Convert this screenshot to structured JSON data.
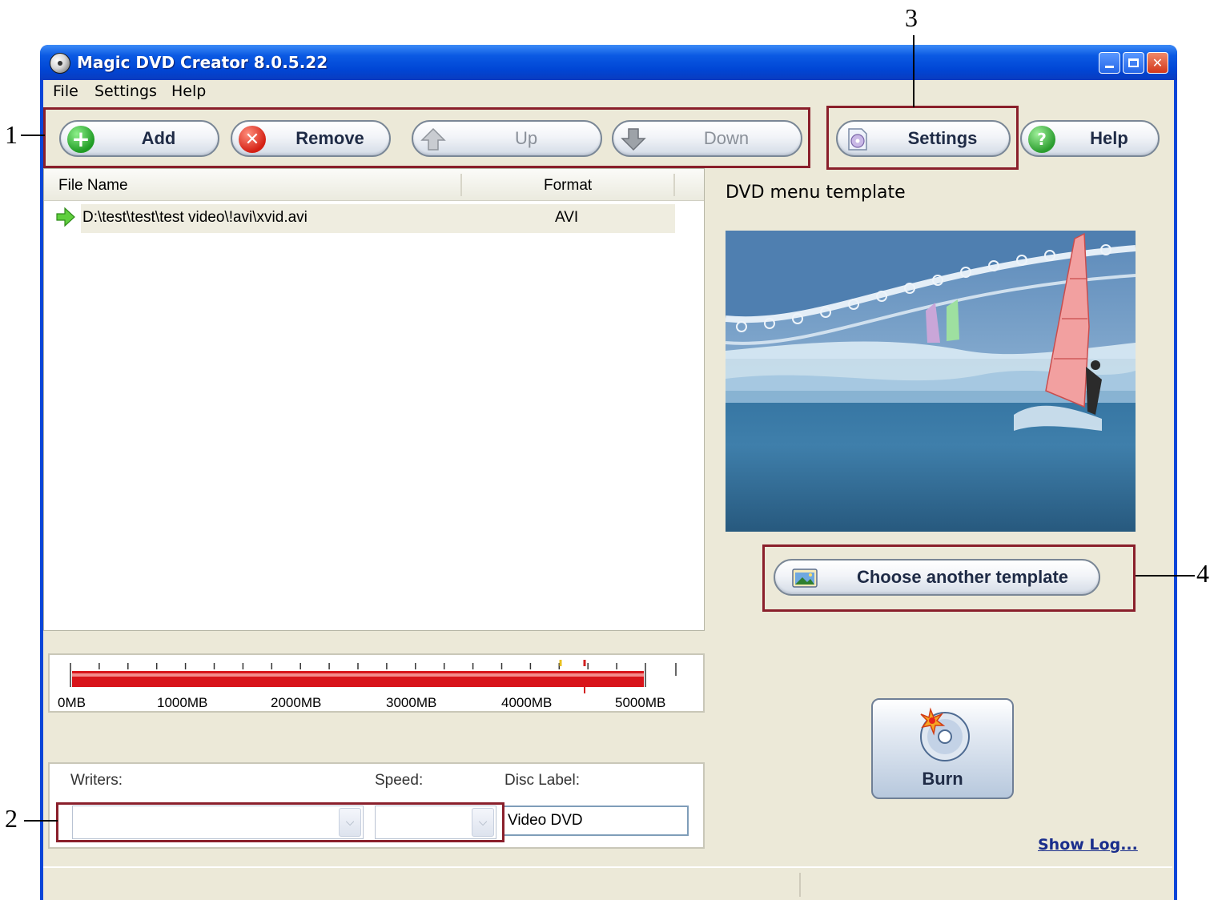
{
  "window": {
    "title": "Magic DVD Creator 8.0.5.22",
    "controls": [
      "minimize",
      "maximize",
      "close"
    ]
  },
  "menu": [
    "File",
    "Settings",
    "Help"
  ],
  "toolbar": {
    "add": "Add",
    "remove": "Remove",
    "up": "Up",
    "down": "Down",
    "settings": "Settings",
    "help": "Help"
  },
  "file_list": {
    "columns": [
      "File Name",
      "Format"
    ],
    "rows": [
      {
        "file_name": "D:\\test\\test\\test video\\!avi\\xvid.avi",
        "format": "AVI"
      }
    ]
  },
  "template": {
    "label": "DVD menu template",
    "choose_button": "Choose another template"
  },
  "capacity": {
    "tick_labels": [
      "0MB",
      "1000MB",
      "2000MB",
      "3000MB",
      "4000MB",
      "5000MB"
    ],
    "used_fraction": 1.0
  },
  "writers": {
    "writers_label": "Writers:",
    "speed_label": "Speed:",
    "disc_label_label": "Disc Label:",
    "writer_value": "",
    "speed_value": "",
    "disc_label_value": "Video DVD"
  },
  "burn": {
    "label": "Burn"
  },
  "show_log": "Show Log...",
  "callouts": [
    "1",
    "2",
    "3",
    "4"
  ],
  "colors": {
    "titlebar": "#0054e3",
    "window_bg": "#ece9d8",
    "progress": "#d8141a",
    "callout_border": "#8a1f2b",
    "link": "#1a2e8c"
  }
}
